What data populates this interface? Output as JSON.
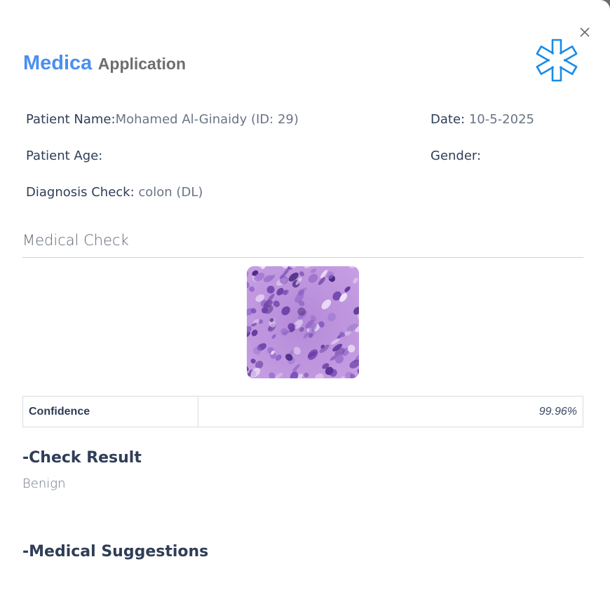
{
  "app": {
    "brand_primary": "Medica",
    "brand_secondary": "Application",
    "accent_color": "#4a8ff0",
    "logo_icon": "star-of-life-icon",
    "close_icon": "close-icon"
  },
  "patient": {
    "name_label": "Patient Name:",
    "name_value": "Mohamed Al-Ginaidy (ID: 29)",
    "date_label": "Date:",
    "date_value": " 10-5-2025",
    "age_label": "Patient Age:",
    "age_value": "",
    "gender_label": "Gender:",
    "gender_value": "",
    "diagnosis_label": "Diagnosis Check:",
    "diagnosis_value": " colon (DL)"
  },
  "medical_check": {
    "title": "Medical Check",
    "image_icon": "histology-scan-image",
    "confidence_label": "Confidence",
    "confidence_value": "99.96%"
  },
  "result": {
    "heading": "-Check Result",
    "value": "Benign"
  },
  "suggestions": {
    "heading": "-Medical Suggestions"
  }
}
